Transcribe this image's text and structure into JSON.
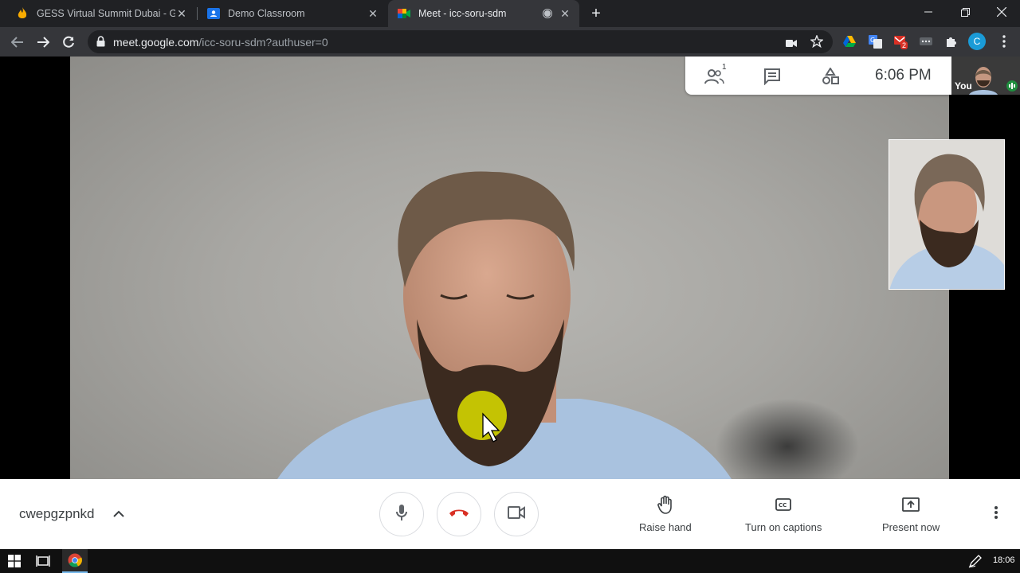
{
  "browser": {
    "tabs": [
      {
        "title": "GESS Virtual Summit Dubai - Goo",
        "favicon": "flame-icon"
      },
      {
        "title": "Demo Classroom",
        "favicon": "classroom-icon"
      },
      {
        "title": "Meet - icc-soru-sdm",
        "favicon": "meet-icon"
      }
    ],
    "address": {
      "host": "meet.google.com",
      "path": "/icc-soru-sdm?authuser=0"
    },
    "badge_count": "2",
    "profile_initial": "C"
  },
  "meet": {
    "participant_count": "1",
    "clock": "6:06 PM",
    "self_label": "You",
    "meeting_code": "cwepgzpnkd",
    "actions": {
      "raise_hand": "Raise hand",
      "captions": "Turn on captions",
      "present": "Present now"
    },
    "colors": {
      "hangup": "#d93025",
      "accent": "#1a73e8",
      "speaking": "#1e8e3e"
    }
  },
  "taskbar": {
    "time": "18:06"
  }
}
